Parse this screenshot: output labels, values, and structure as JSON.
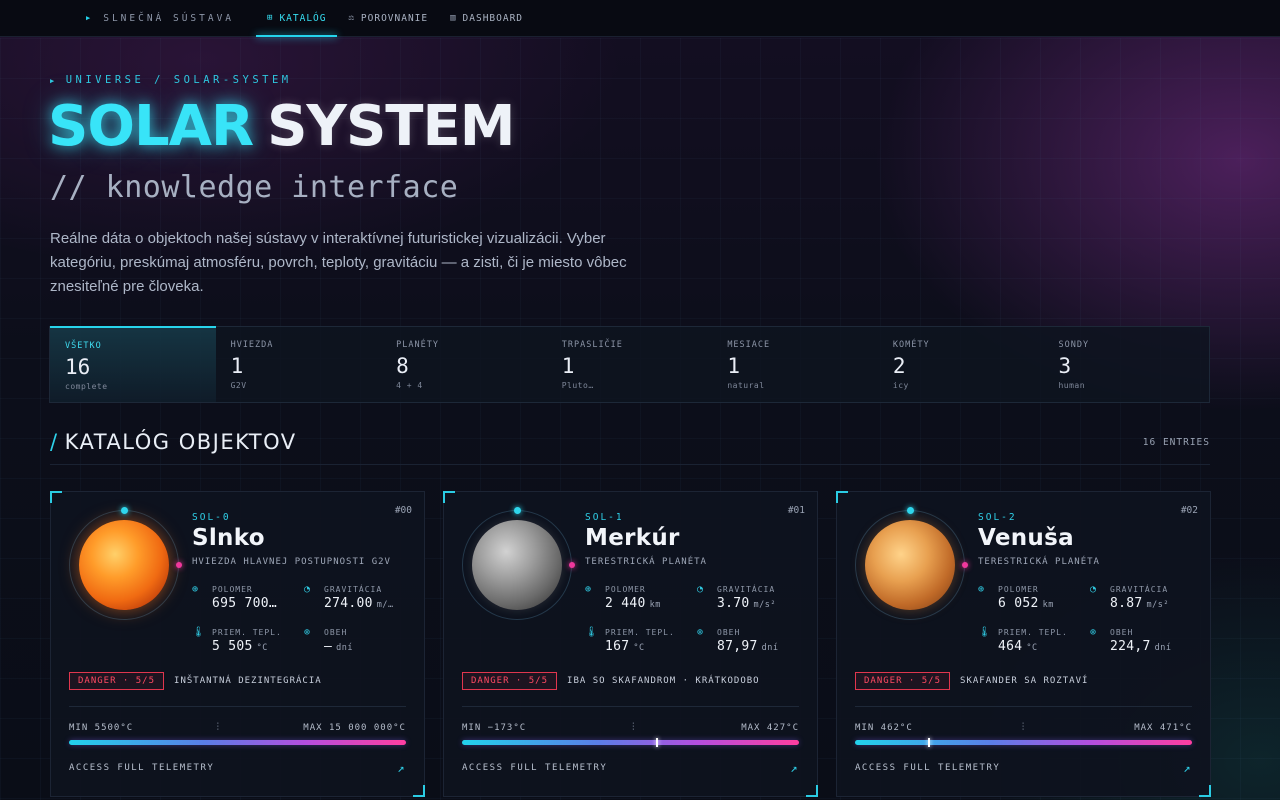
{
  "nav": {
    "brand": "SLNEČNÁ SÚSTAVA",
    "items": [
      {
        "label": "KATALÓG",
        "icon": "grid-icon",
        "active": true
      },
      {
        "label": "POROVNANIE",
        "icon": "scale-icon",
        "active": false
      },
      {
        "label": "DASHBOARD",
        "icon": "bar-chart-icon",
        "active": false
      }
    ]
  },
  "hero": {
    "breadcrumb": "UNIVERSE / SOLAR-SYSTEM",
    "title_a": "SOLAR",
    "title_b": "SYSTEM",
    "subtitle": "// knowledge interface",
    "intro": "Reálne dáta o objektoch našej sústavy v interaktívnej futuristickej vizualizácii. Vyber kategóriu, preskúmaj atmosféru, povrch, teploty, gravitáciu — a zisti, či je miesto vôbec znesiteľné pre človeka."
  },
  "stats": [
    {
      "label": "VŠETKO",
      "value": "16",
      "sub": "complete",
      "active": true
    },
    {
      "label": "HVIEZDA",
      "value": "1",
      "sub": "G2V"
    },
    {
      "label": "PLANÉTY",
      "value": "8",
      "sub": "4 + 4"
    },
    {
      "label": "TRPASLIČIE",
      "value": "1",
      "sub": "Pluto…"
    },
    {
      "label": "MESIACE",
      "value": "1",
      "sub": "natural"
    },
    {
      "label": "KOMÉTY",
      "value": "2",
      "sub": "icy"
    },
    {
      "label": "SONDY",
      "value": "3",
      "sub": "human"
    }
  ],
  "section": {
    "title": "KATALÓG OBJEKTOV",
    "entries": "16 ENTRIES"
  },
  "colors": {
    "accent": "#2fd6ec",
    "danger": "#e0364e",
    "pink": "#f0389c"
  },
  "labels": {
    "radius": "POLOMER",
    "gravity": "GRAVITÁCIA",
    "temp": "PRIEM. TEPL.",
    "orbit": "OBEH",
    "access": "ACCESS FULL TELEMETRY"
  },
  "cards": [
    {
      "num": "#00",
      "code": "SOL-0",
      "name": "Slnko",
      "type": "HVIEZDA HLAVNEJ POSTUPNOSTI G2V",
      "radius": "695 700…",
      "radius_unit": "",
      "gravity": "274.00",
      "gravity_unit": "m/…",
      "temp": "5 505",
      "temp_unit": "°C",
      "orbit": "—",
      "orbit_unit": "dní",
      "danger": "DANGER · 5/5",
      "danger_text": "INŠTANTNÁ DEZINTEGRÁCIA",
      "min": "MIN 5500°C",
      "max": "MAX 15 000 000°C",
      "marker": null
    },
    {
      "num": "#01",
      "code": "SOL-1",
      "name": "Merkúr",
      "type": "TERESTRICKÁ PLANÉTA",
      "radius": "2 440",
      "radius_unit": "km",
      "gravity": "3.70",
      "gravity_unit": "m/s²",
      "temp": "167",
      "temp_unit": "°C",
      "orbit": "87,97",
      "orbit_unit": "dní",
      "danger": "DANGER · 5/5",
      "danger_text": "IBA SO SKAFANDROM · KRÁTKODOBO",
      "min": "MIN −173°C",
      "max": "MAX 427°C",
      "marker": 0.58
    },
    {
      "num": "#02",
      "code": "SOL-2",
      "name": "Venuša",
      "type": "TERESTRICKÁ PLANÉTA",
      "radius": "6 052",
      "radius_unit": "km",
      "gravity": "8.87",
      "gravity_unit": "m/s²",
      "temp": "464",
      "temp_unit": "°C",
      "orbit": "224,7",
      "orbit_unit": "dní",
      "danger": "DANGER · 5/5",
      "danger_text": "SKAFANDER SA ROZTAVÍ",
      "min": "MIN 462°C",
      "max": "MAX 471°C",
      "marker": 0.22
    }
  ]
}
